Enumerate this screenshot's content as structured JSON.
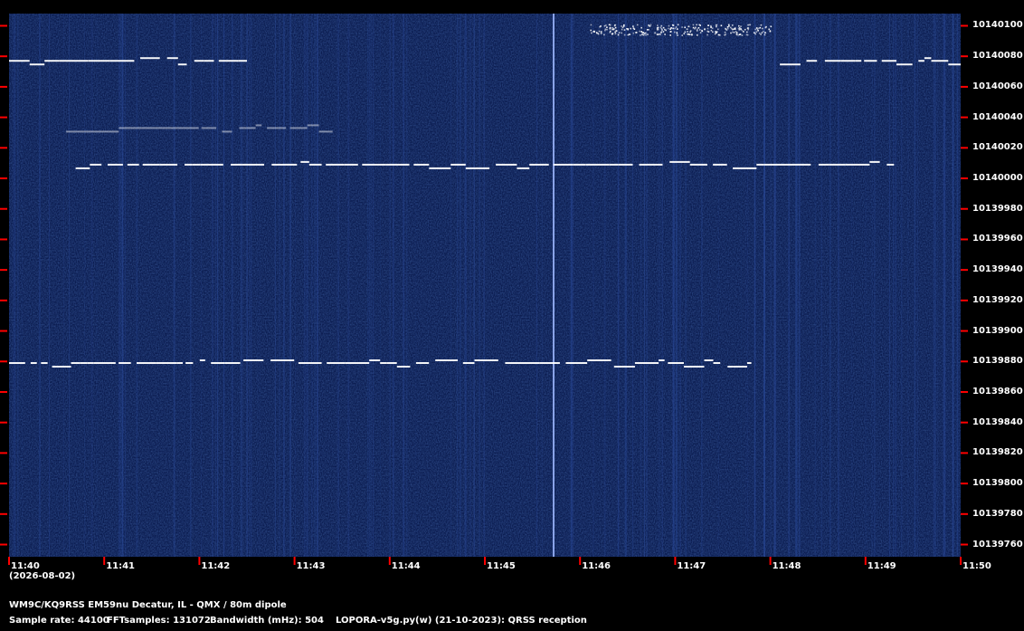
{
  "colors": {
    "background": "#000000",
    "waterfall_dark": "#0a1a4a",
    "waterfall_mid": "#173070",
    "trace": "#ffffff",
    "tick": "#ff0000",
    "label": "#ffffff"
  },
  "freq_axis": {
    "labels": [
      "10140100",
      "10140080",
      "10140060",
      "10140040",
      "10140020",
      "10140000",
      "10139980",
      "10139960",
      "10139940",
      "10139920",
      "10139900",
      "10139880",
      "10139860",
      "10139840",
      "10139820",
      "10139800",
      "10139780",
      "10139760"
    ]
  },
  "time_axis": {
    "labels": [
      "11:40",
      "11:41",
      "11:42",
      "11:43",
      "11:44",
      "11:45",
      "11:46",
      "11:47",
      "11:48",
      "11:49",
      "11:50"
    ],
    "date": "(2026-08-02)"
  },
  "footer": {
    "station": "WM9C/KQ9RSS EM59nu Decatur, IL - QMX / 80m dipole",
    "sample_rate": "Sample rate: 44100",
    "fft": "FFTsamples: 131072",
    "bandwidth": "Bandwidth (mHz): 504",
    "software": "LOPORA-v5g.py(w) (21-10-2023): QRSS reception"
  },
  "traces": [
    {
      "name": "signal-10140077",
      "freq_hz": 10140077,
      "start": "11:40",
      "end": "11:42.5"
    },
    {
      "name": "signal-10140077-b",
      "freq_hz": 10140077,
      "start": "11:48.1",
      "end": "11:50"
    },
    {
      "name": "signal-10140009",
      "freq_hz": 10140009,
      "start": "11:40.7",
      "end": "11:49.3"
    },
    {
      "name": "signal-10140033",
      "freq_hz": 10140033,
      "start": "11:40.6",
      "end": "11:43.4"
    },
    {
      "name": "signal-10139879",
      "freq_hz": 10139879,
      "start": "11:40",
      "end": "11:47.8"
    },
    {
      "name": "noise-burst-top",
      "freq_hz": 10140100,
      "start": "11:46.1",
      "end": "11:48"
    }
  ]
}
